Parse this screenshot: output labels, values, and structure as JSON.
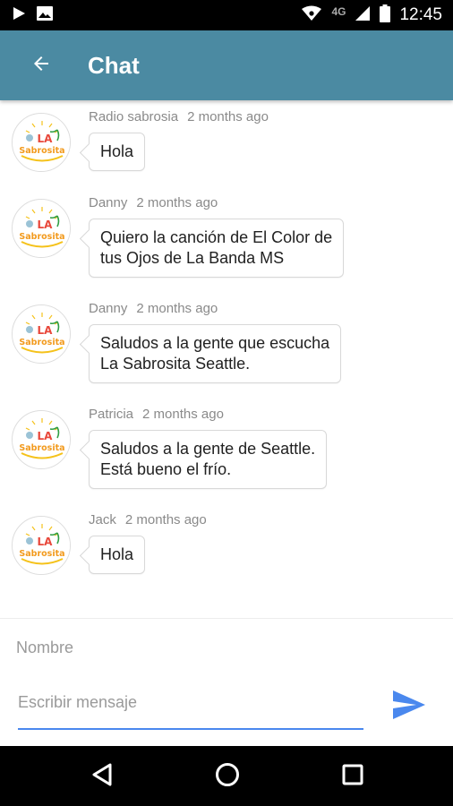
{
  "status_bar": {
    "time": "12:45",
    "network": "4G",
    "icons": [
      "play-icon",
      "image-icon",
      "wifi-icon",
      "signal-icon",
      "battery-icon"
    ]
  },
  "app_bar": {
    "title": "Chat",
    "back_icon": "arrow-left-icon",
    "color": "#4b8aa2"
  },
  "messages": [
    {
      "author": "Radio sabrosia",
      "time": "2 months ago",
      "lines": [
        "Hola"
      ]
    },
    {
      "author": "Danny",
      "time": "2 months ago",
      "lines": [
        "Quiero la canción de El Color de",
        "tus Ojos de La Banda MS"
      ]
    },
    {
      "author": "Danny",
      "time": "2 months ago",
      "lines": [
        "Saludos a la gente que escucha",
        "La Sabrosita Seattle."
      ]
    },
    {
      "author": "Patricia",
      "time": "2 months ago",
      "lines": [
        "Saludos a la gente de Seattle.",
        "Está bueno el frío."
      ]
    },
    {
      "author": "Jack",
      "time": "2 months ago",
      "lines": [
        "Hola"
      ]
    }
  ],
  "avatar_logo": {
    "line1": "LA",
    "line2": "Sabrosita"
  },
  "composer": {
    "name_placeholder": "Nombre",
    "message_placeholder": "Escribir mensaje",
    "send_icon": "send-icon",
    "accent": "#4a88ee"
  },
  "nav_bar": {
    "icons": [
      "back-triangle-icon",
      "home-circle-icon",
      "recents-square-icon"
    ]
  }
}
